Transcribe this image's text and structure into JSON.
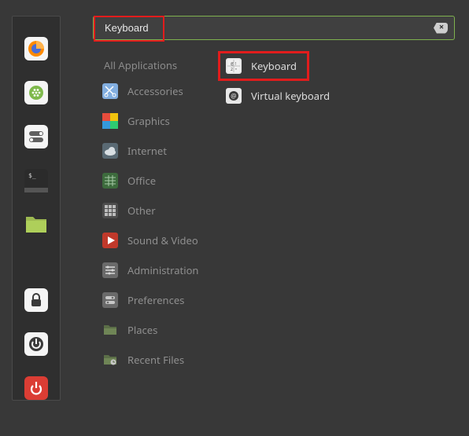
{
  "search": {
    "value": "Keyboard",
    "placeholder": ""
  },
  "favorites": [
    {
      "name": "firefox-icon"
    },
    {
      "name": "chat-icon"
    },
    {
      "name": "toggles-icon"
    },
    {
      "name": "terminal-icon"
    },
    {
      "name": "files-icon"
    },
    {
      "name": "spacer"
    },
    {
      "name": "lock-icon"
    },
    {
      "name": "logout-icon"
    },
    {
      "name": "power-icon"
    }
  ],
  "categories": {
    "all": "All Applications",
    "items": [
      {
        "label": "Accessories",
        "icon": "scissors-icon"
      },
      {
        "label": "Graphics",
        "icon": "rgb-icon"
      },
      {
        "label": "Internet",
        "icon": "cloud-icon"
      },
      {
        "label": "Office",
        "icon": "spreadsheet-icon"
      },
      {
        "label": "Other",
        "icon": "grid-icon"
      },
      {
        "label": "Sound & Video",
        "icon": "play-icon"
      },
      {
        "label": "Administration",
        "icon": "sliders-icon"
      },
      {
        "label": "Preferences",
        "icon": "controls-icon"
      },
      {
        "label": "Places",
        "icon": "folder-icon"
      },
      {
        "label": "Recent Files",
        "icon": "folder-recent-icon"
      }
    ]
  },
  "results": [
    {
      "label": "Keyboard",
      "icon": "keyboard-icon",
      "highlighted": true
    },
    {
      "label": "Virtual keyboard",
      "icon": "at-icon",
      "highlighted": false
    }
  ]
}
